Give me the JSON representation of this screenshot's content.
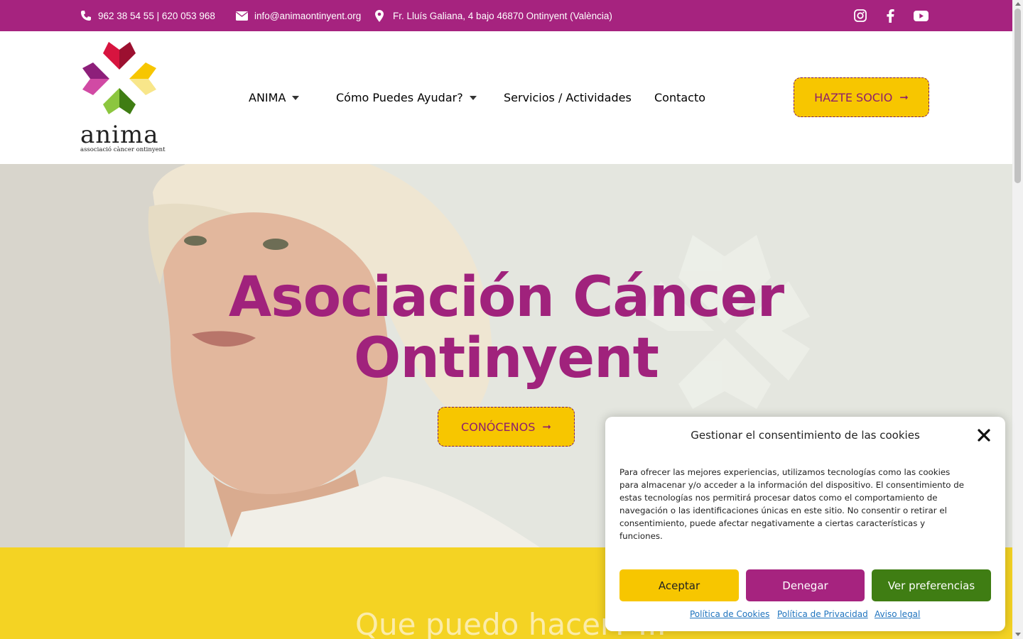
{
  "topbar": {
    "phone": "962 38 54 55 | 620 053 968",
    "email": "info@animaontinyent.org",
    "address": "Fr. Lluís Galiana, 4 bajo 46870 Ontinyent (València)",
    "bg_color": "#a6237f",
    "icons": [
      "phone-icon",
      "envelope-icon",
      "map-pin-icon",
      "instagram-icon",
      "facebook-icon",
      "youtube-icon"
    ]
  },
  "logo": {
    "word": "anima",
    "subtitle": "associació càncer ontinyent"
  },
  "nav": {
    "items": [
      {
        "label": "ANIMA",
        "has_dropdown": true
      },
      {
        "label": "Cómo Puedes Ayudar?",
        "has_dropdown": true
      },
      {
        "label": "Servicios / Actividades",
        "has_dropdown": false
      },
      {
        "label": "Contacto",
        "has_dropdown": false
      }
    ],
    "cta_label": "HAZTE SOCIO"
  },
  "hero": {
    "title_line1": "Asociación Cáncer",
    "title_line2": "Ontinyent",
    "button_label": "CONÓCENOS",
    "title_color": "#a0227c"
  },
  "section2": {
    "title": "Que puedo hacer? ..."
  },
  "cookie": {
    "title": "Gestionar el consentimiento de las cookies",
    "text": "Para ofrecer las mejores experiencias, utilizamos tecnologías como las cookies para almacenar y/o acceder a la información del dispositivo. El consentimiento de estas tecnologías nos permitirá procesar datos como el comportamiento de navegación o las identificaciones únicas en este sitio. No consentir o retirar el consentimiento, puede afectar negativamente a ciertas características y funciones.",
    "accept_label": "Aceptar",
    "deny_label": "Denegar",
    "prefs_label": "Ver preferencias",
    "links": [
      "Política de Cookies",
      "Política de Privacidad",
      "Aviso legal"
    ]
  },
  "colors": {
    "accent_purple": "#a6237f",
    "accent_yellow": "#f7c600",
    "accent_green": "#3f7d13"
  }
}
